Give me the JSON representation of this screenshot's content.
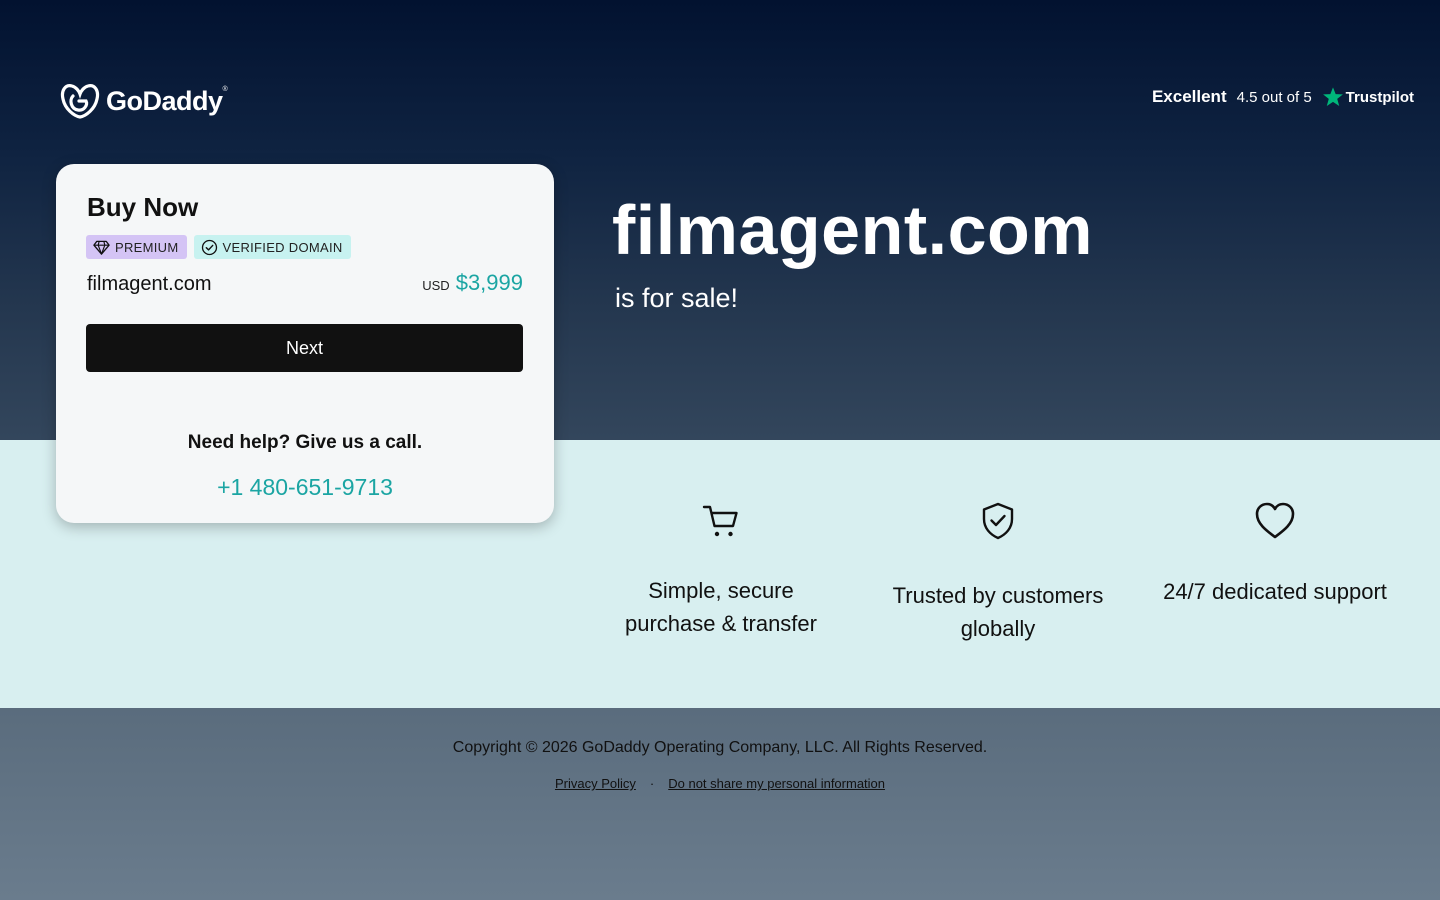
{
  "brand": {
    "name": "GoDaddy",
    "trademark": "®",
    "accent_color": "#1ba5a3",
    "hero_gradient": [
      "#021230",
      "#33465c"
    ],
    "band_color": "#d8eff0"
  },
  "trustpilot": {
    "rating_word": "Excellent",
    "score_text": "4.5 out of 5",
    "brand": "Trustpilot",
    "star_color": "#00b67a",
    "icon": "star-icon"
  },
  "buy_card": {
    "title": "Buy Now",
    "badges": [
      {
        "label": "PREMIUM",
        "icon": "diamond-icon",
        "color": "#d4c4f5"
      },
      {
        "label": "VERIFIED DOMAIN",
        "icon": "check-circle-icon",
        "color": "#c7f2f0"
      }
    ],
    "domain": "filmagent.com",
    "currency": "USD",
    "price": "$3,999",
    "next_label": "Next",
    "help_text": "Need help? Give us a call.",
    "phone": "+1 480-651-9713"
  },
  "hero": {
    "domain": "filmagent.com",
    "tagline": "is for sale!"
  },
  "features": [
    {
      "icon": "cart-icon",
      "label_line1": "Simple, secure",
      "label_line2": "purchase & transfer"
    },
    {
      "icon": "shield-check-icon",
      "label_line1": "Trusted by customers",
      "label_line2": "globally"
    },
    {
      "icon": "heart-icon",
      "label_line1": "24/7 dedicated support",
      "label_line2": ""
    }
  ],
  "footer": {
    "copyright": "Copyright © 2026 GoDaddy Operating Company, LLC. All Rights Reserved.",
    "links": [
      {
        "label": "Privacy Policy"
      },
      {
        "label": "Do not share my personal information"
      }
    ],
    "separator": "·"
  }
}
